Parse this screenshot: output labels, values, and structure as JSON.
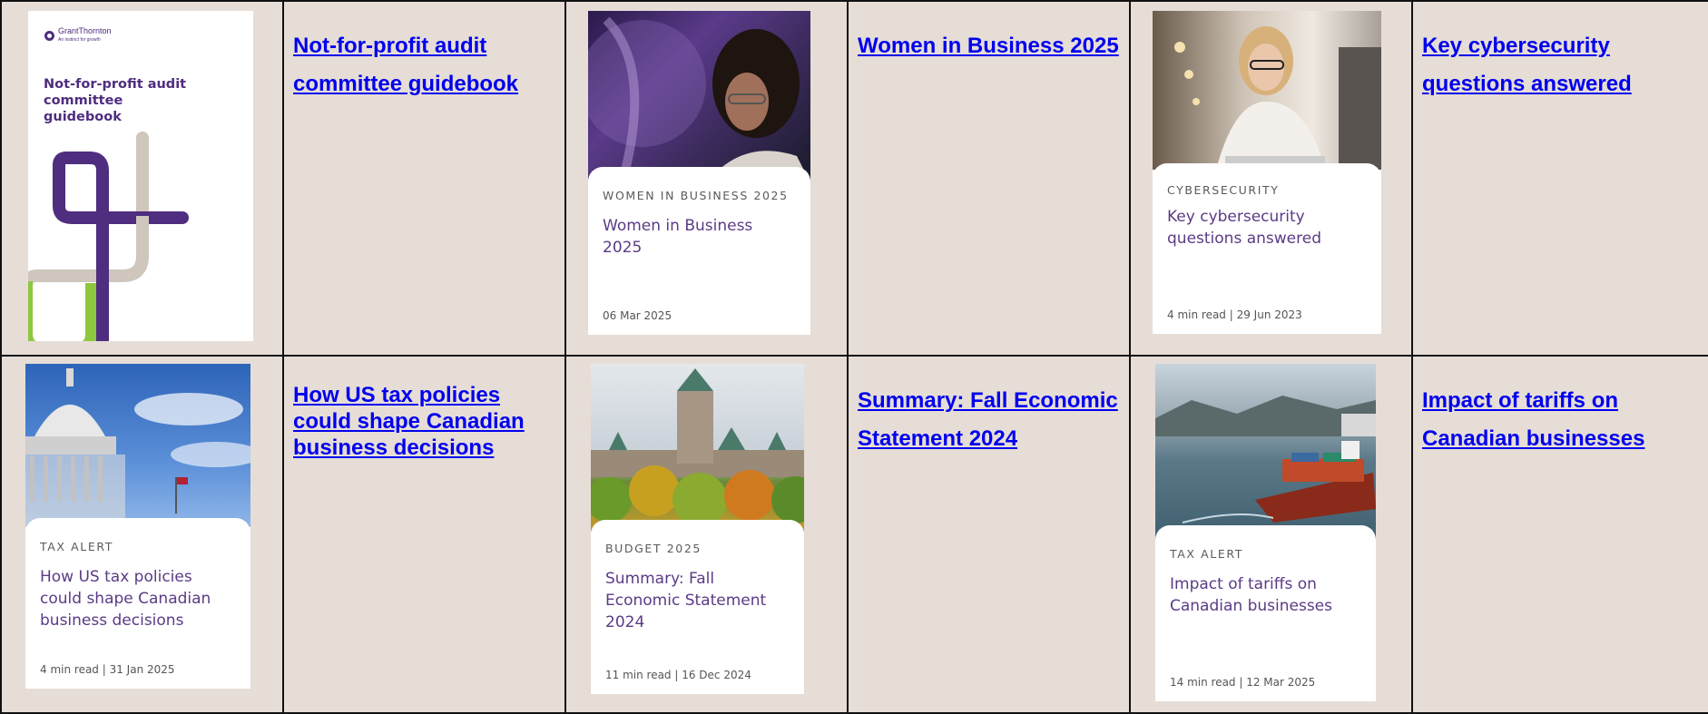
{
  "colors": {
    "background": "#e6ddd7",
    "link": "#0000ee",
    "card_title": "#5b3b86",
    "brand_purple": "#4f2d7f"
  },
  "rows": [
    {
      "cells": [
        {
          "type": "cover",
          "logo_text": "GrantThornton",
          "logo_tagline": "An instinct for growth",
          "cover_title": "Not-for-profit audit committee guidebook"
        },
        {
          "type": "link",
          "text": "Not-for-profit audit committee guidebook"
        },
        {
          "type": "card",
          "eyebrow": "WOMEN IN BUSINESS 2025",
          "title": "Women in Business 2025",
          "meta": "06 Mar 2025"
        },
        {
          "type": "link",
          "text": "Women in Business 2025"
        },
        {
          "type": "card",
          "eyebrow": "CYBERSECURITY",
          "title": "Key cybersecurity questions answered",
          "meta": "4 min read | 29 Jun 2023"
        },
        {
          "type": "link",
          "text": "Key cybersecurity questions answered"
        }
      ]
    },
    {
      "cells": [
        {
          "type": "card",
          "eyebrow": "TAX ALERT",
          "title": "How US tax policies could shape Canadian business decisions",
          "meta": "4 min read | 31 Jan 2025"
        },
        {
          "type": "link",
          "text": "How US tax policies could shape Canadian business decisions"
        },
        {
          "type": "card",
          "eyebrow": "BUDGET 2025",
          "title": "Summary: Fall Economic Statement 2024",
          "meta": "11 min read | 16 Dec 2024"
        },
        {
          "type": "link",
          "text": "Summary: Fall Economic Statement 2024"
        },
        {
          "type": "card",
          "eyebrow": "TAX ALERT",
          "title": "Impact of tariffs on Canadian businesses",
          "meta": "14 min read | 12 Mar 2025"
        },
        {
          "type": "link",
          "text": "Impact of tariffs on Canadian businesses"
        }
      ]
    }
  ]
}
